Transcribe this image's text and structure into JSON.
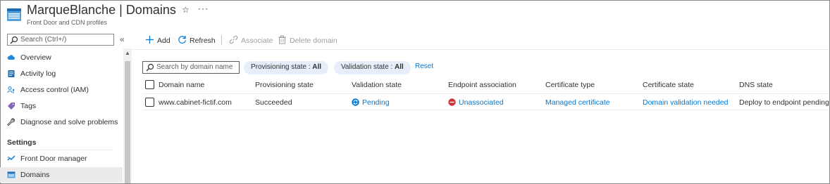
{
  "header": {
    "resource_name": "MarqueBlanche",
    "separator": "|",
    "page_name": "Domains",
    "subtitle": "Front Door and CDN profiles",
    "star_glyph": "☆",
    "more_glyph": "···"
  },
  "sidebar": {
    "search_placeholder": "Search (Ctrl+/)",
    "collapse_glyph": "«",
    "items": [
      {
        "label": "Overview",
        "icon": "cloud-icon"
      },
      {
        "label": "Activity log",
        "icon": "activity-log-icon"
      },
      {
        "label": "Access control (IAM)",
        "icon": "iam-icon"
      },
      {
        "label": "Tags",
        "icon": "tag-icon"
      },
      {
        "label": "Diagnose and solve problems",
        "icon": "wrench-icon"
      }
    ],
    "section_settings": "Settings",
    "settings_items": [
      {
        "label": "Front Door manager",
        "icon": "front-door-icon"
      },
      {
        "label": "Domains",
        "icon": "domains-icon",
        "active": true
      }
    ]
  },
  "toolbar": {
    "add": "Add",
    "refresh": "Refresh",
    "associate": "Associate",
    "delete_domain": "Delete domain"
  },
  "filters": {
    "search_placeholder": "Search by domain name",
    "provisioning_label": "Provisioning state : ",
    "provisioning_value": "All",
    "validation_label": "Validation state : ",
    "validation_value": "All",
    "reset": "Reset"
  },
  "table": {
    "columns": [
      "Domain name",
      "Provisioning state",
      "Validation state",
      "Endpoint association",
      "Certificate type",
      "Certificate state",
      "DNS state"
    ],
    "rows": [
      {
        "domain": "www.cabinet-fictif.com",
        "provisioning": "Succeeded",
        "validation": "Pending",
        "endpoint": "Unassociated",
        "cert_type": "Managed certificate",
        "cert_state": "Domain validation needed",
        "dns_state": "Deploy to endpoint pending"
      }
    ]
  },
  "colors": {
    "accent": "#0078d4",
    "error": "#d13438",
    "pill_bg": "#e5eef9"
  }
}
